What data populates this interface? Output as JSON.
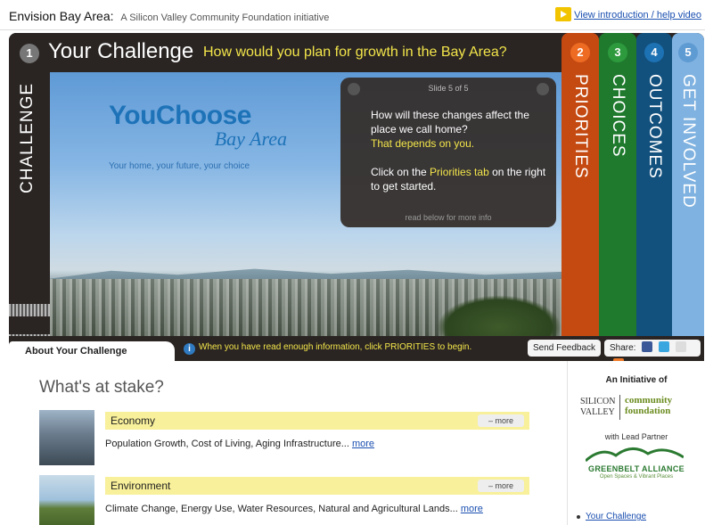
{
  "header": {
    "brand": "Envision Bay Area:",
    "tagline": "A Silicon Valley Community Foundation initiative",
    "help_link": "View introduction / help video"
  },
  "challenge": {
    "step": "1",
    "title": "Your Challenge",
    "question": "How would you plan for growth in the Bay Area?",
    "rail_label": "CHALLENGE"
  },
  "logo": {
    "name": "YouChoose",
    "sub": "Bay Area",
    "tagline": "Your home, your future, your choice"
  },
  "slide": {
    "counter": "Slide 5 of 5",
    "line1": "How will these changes affect the place we call home?",
    "line2": "That depends on you.",
    "line3_a": "Click on the",
    "line3_hl": "Priorities tab",
    "line3_b": "on the right to get started.",
    "footer": "read below for more info"
  },
  "tabs": [
    {
      "num": "2",
      "label": "PRIORITIES",
      "color": "#c44a12"
    },
    {
      "num": "3",
      "label": "CHOICES",
      "color": "#1f7a2e"
    },
    {
      "num": "4",
      "label": "OUTCOMES",
      "color": "#12507d"
    },
    {
      "num": "5",
      "label": "GET INVOLVED",
      "color": "#7fb2e0"
    }
  ],
  "strip": {
    "about_tab": "About Your Challenge",
    "info_icon": "i",
    "info": "When you have read enough information, click PRIORITIES to begin.",
    "feedback": "Send Feedback",
    "share": "Share:"
  },
  "main": {
    "heading": "What's at stake?",
    "items": [
      {
        "name": "Economy",
        "more_btn": "more",
        "desc": "Population Growth, Cost of Living, Aging Infrastructure...",
        "more_link": "more"
      },
      {
        "name": "Environment",
        "more_btn": "more",
        "desc": "Climate Change, Energy Use, Water Resources, Natural and Agricultural Lands...",
        "more_link": "more"
      }
    ]
  },
  "sidebar": {
    "head": "An Initiative of",
    "svcf_left": "SILICON VALLEY",
    "svcf_right": "community foundation",
    "partner": "with Lead Partner",
    "greenbelt_name": "GREENBELT ALLIANCE",
    "greenbelt_sub": "Open Spaces & Vibrant Places",
    "link": "Your Challenge"
  }
}
